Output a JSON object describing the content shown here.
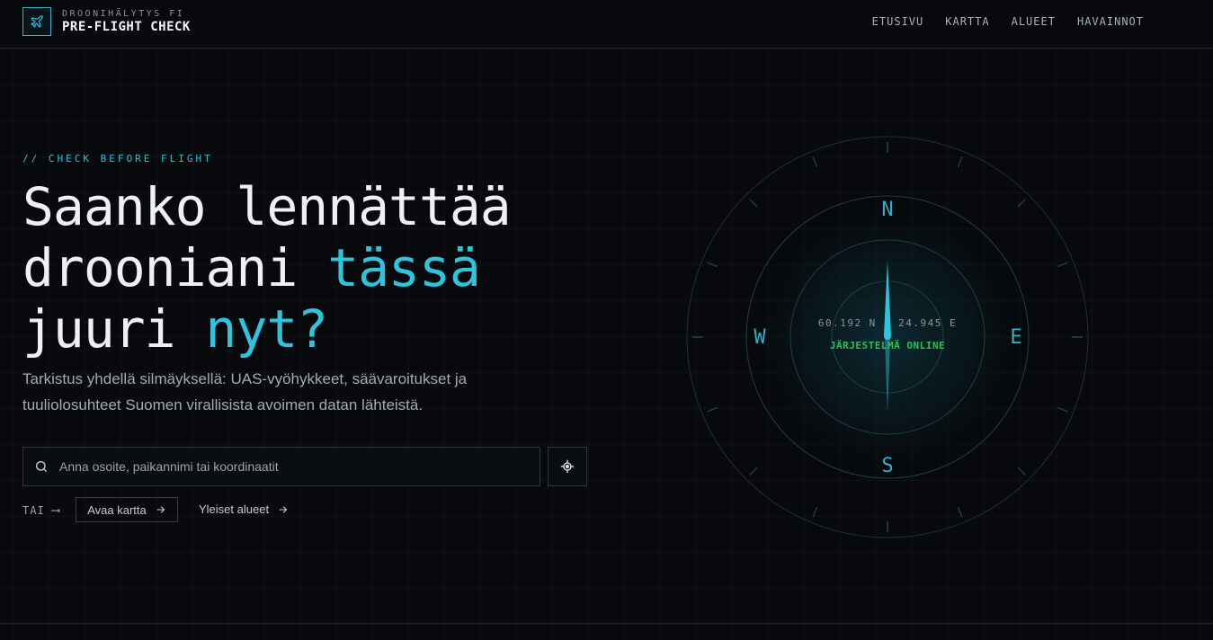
{
  "header": {
    "brand_small": "DROONIHÄLYTYS FI",
    "brand_title": "PRE-FLIGHT CHECK",
    "logo_icon": "plane-icon",
    "nav": [
      {
        "label": "ETUSIVU"
      },
      {
        "label": "KARTTA"
      },
      {
        "label": "ALUEET"
      },
      {
        "label": "HAVAINNOT"
      }
    ]
  },
  "hero": {
    "eyebrow": "// CHECK BEFORE FLIGHT",
    "headline": {
      "line1": "Saanko lennättää",
      "line2_a": "drooniani ",
      "line2_b": "tässä",
      "line3_a": "juuri ",
      "line3_b": "nyt?"
    },
    "subtitle": "Tarkistus yhdellä silmäyksellä: UAS-vyöhykkeet, säävaroitukset ja tuuliolosuhteet Suomen virallisista avoimen datan lähteistä."
  },
  "search": {
    "placeholder": "Anna osoite, paikannimi tai koordinaatit",
    "value": "",
    "icon": "search-icon",
    "locate_icon": "crosshair-icon"
  },
  "alternatives": {
    "or_label": "TAI",
    "open_map_label": "Avaa kartta",
    "public_areas_label": "Yleiset alueet"
  },
  "compass": {
    "north": "N",
    "south": "S",
    "east": "E",
    "west": "W",
    "coordinates": "60.192 N · 24.945 E",
    "status": "JÄRJESTELMÄ ONLINE"
  },
  "colors": {
    "accent": "#2ec4dd",
    "status_ok": "#2bbf5a",
    "background": "#07090c"
  }
}
